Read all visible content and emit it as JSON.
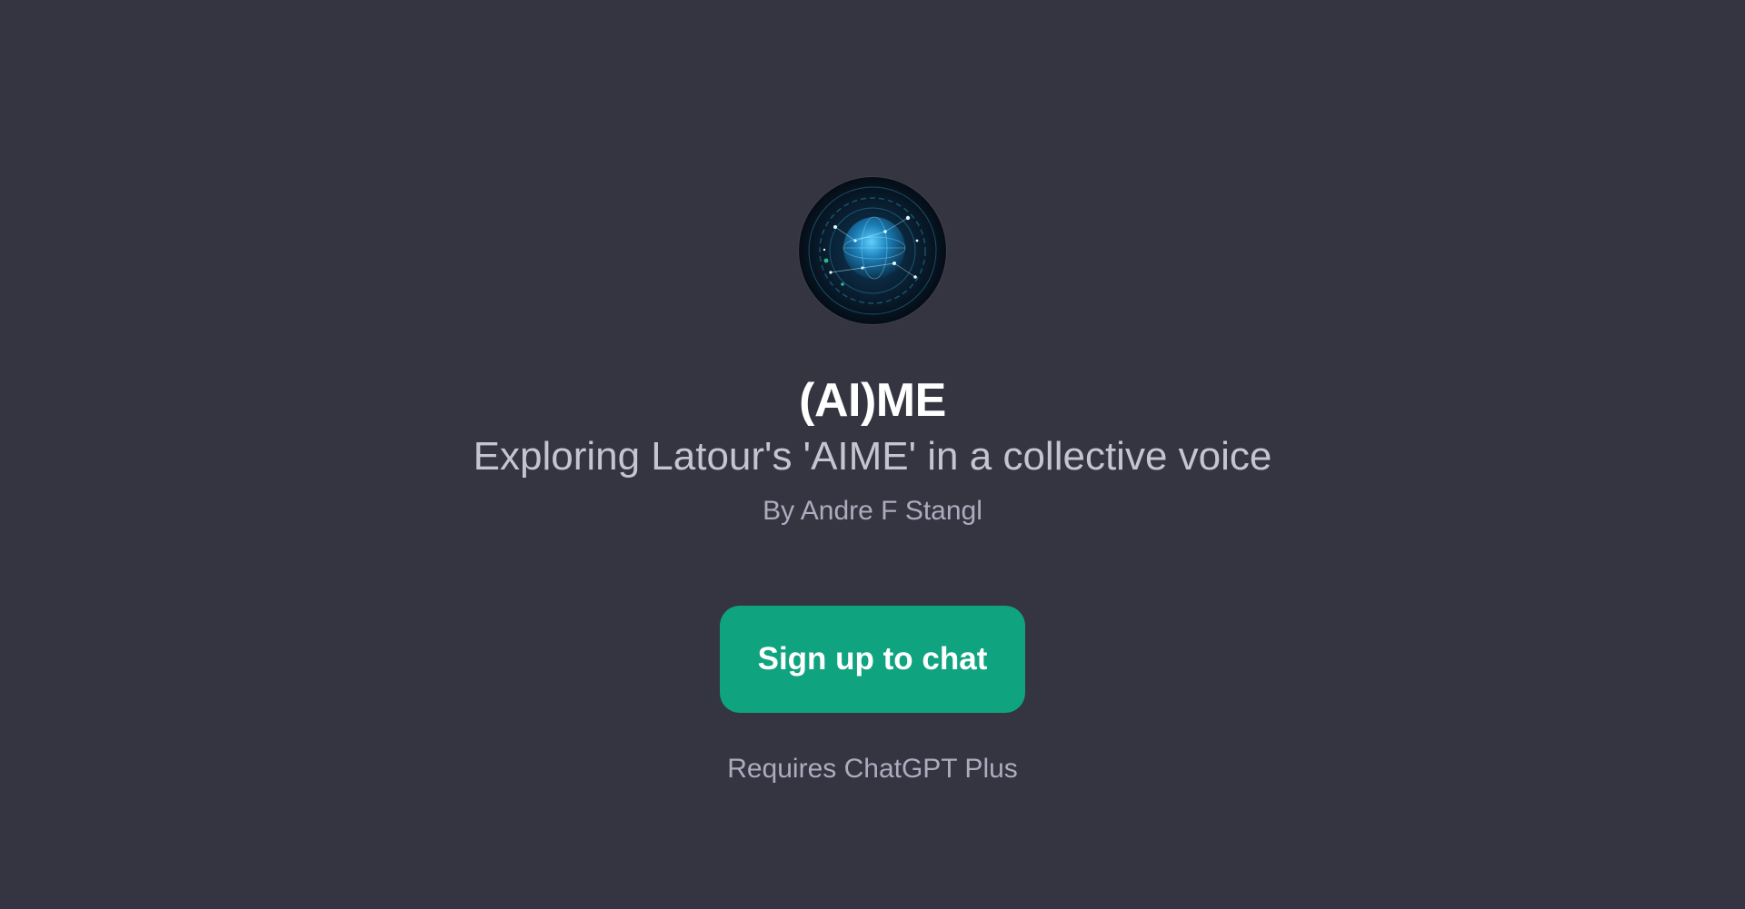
{
  "gpt": {
    "avatar_icon": "cosmic-globe-network-icon",
    "title": "(AI)ME",
    "description": "Exploring Latour's 'AIME' in a collective voice",
    "author": "By Andre F Stangl"
  },
  "cta": {
    "label": "Sign up to chat"
  },
  "note": "Requires ChatGPT Plus",
  "colors": {
    "background": "#343541",
    "button": "#10a37f",
    "title": "#ffffff",
    "subtitle": "#c5c5d2",
    "muted": "#acacbe"
  }
}
